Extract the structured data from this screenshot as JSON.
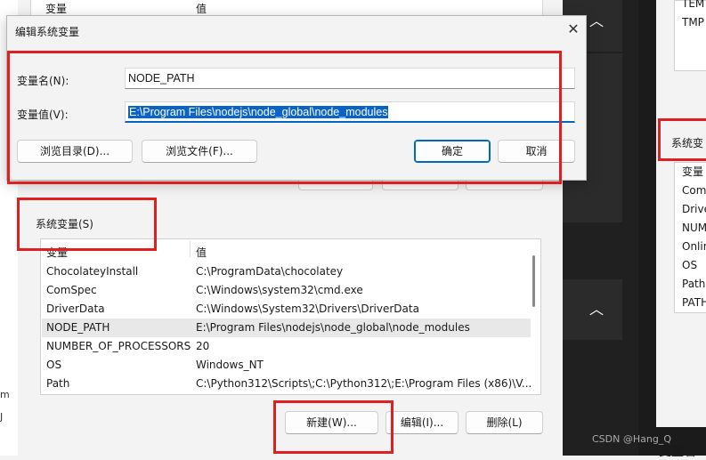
{
  "background_table": {
    "col_variable": "变量",
    "col_value": "值"
  },
  "edit_dialog": {
    "title": "编辑系统变量",
    "name_label": "变量名(N):",
    "name_value": "NODE_PATH",
    "value_label": "变量值(V):",
    "value_value": "E:\\Program Files\\nodejs\\node_global\\node_modules",
    "browse_dir_button": "浏览目录(D)...",
    "browse_file_button": "浏览文件(F)...",
    "ok_button": "确定",
    "cancel_button": "取消",
    "close_glyph": "✕"
  },
  "system_variables": {
    "label": "系统变量(S)",
    "col_variable": "变量",
    "col_value": "值",
    "rows": [
      {
        "name": "ChocolateyInstall",
        "value": "C:\\ProgramData\\chocolatey"
      },
      {
        "name": "ComSpec",
        "value": "C:\\Windows\\system32\\cmd.exe"
      },
      {
        "name": "DriverData",
        "value": "C:\\Windows\\System32\\Drivers\\DriverData"
      },
      {
        "name": "NODE_PATH",
        "value": "E:\\Program Files\\nodejs\\node_global\\node_modules"
      },
      {
        "name": "NUMBER_OF_PROCESSORS",
        "value": "20"
      },
      {
        "name": "OS",
        "value": "Windows_NT"
      },
      {
        "name": "Path",
        "value": "C:\\Python312\\Scripts\\;C:\\Python312\\;E:\\Program Files (x86)\\V..."
      }
    ],
    "selected_index": 3,
    "new_button": "新建(W)...",
    "edit_button": "编辑(I)...",
    "delete_button": "删除(L)"
  },
  "right_window": {
    "top_items": [
      "TEM",
      "TMP"
    ],
    "section_label": "系统变",
    "col_variable": "变量",
    "items": [
      "Com",
      "Drive",
      "NUM",
      "Onlin",
      "OS",
      "Path",
      "PATH"
    ],
    "bottom_text": "变量名"
  },
  "left_strip": {
    "fragments": [
      "m",
      "J"
    ]
  },
  "chevron_glyph": "︿",
  "watermark": "CSDN @Hang_Q",
  "colors": {
    "annotation_red": "#e02020",
    "selection_blue": "#0a64c8",
    "primary_border": "#0067c0"
  }
}
